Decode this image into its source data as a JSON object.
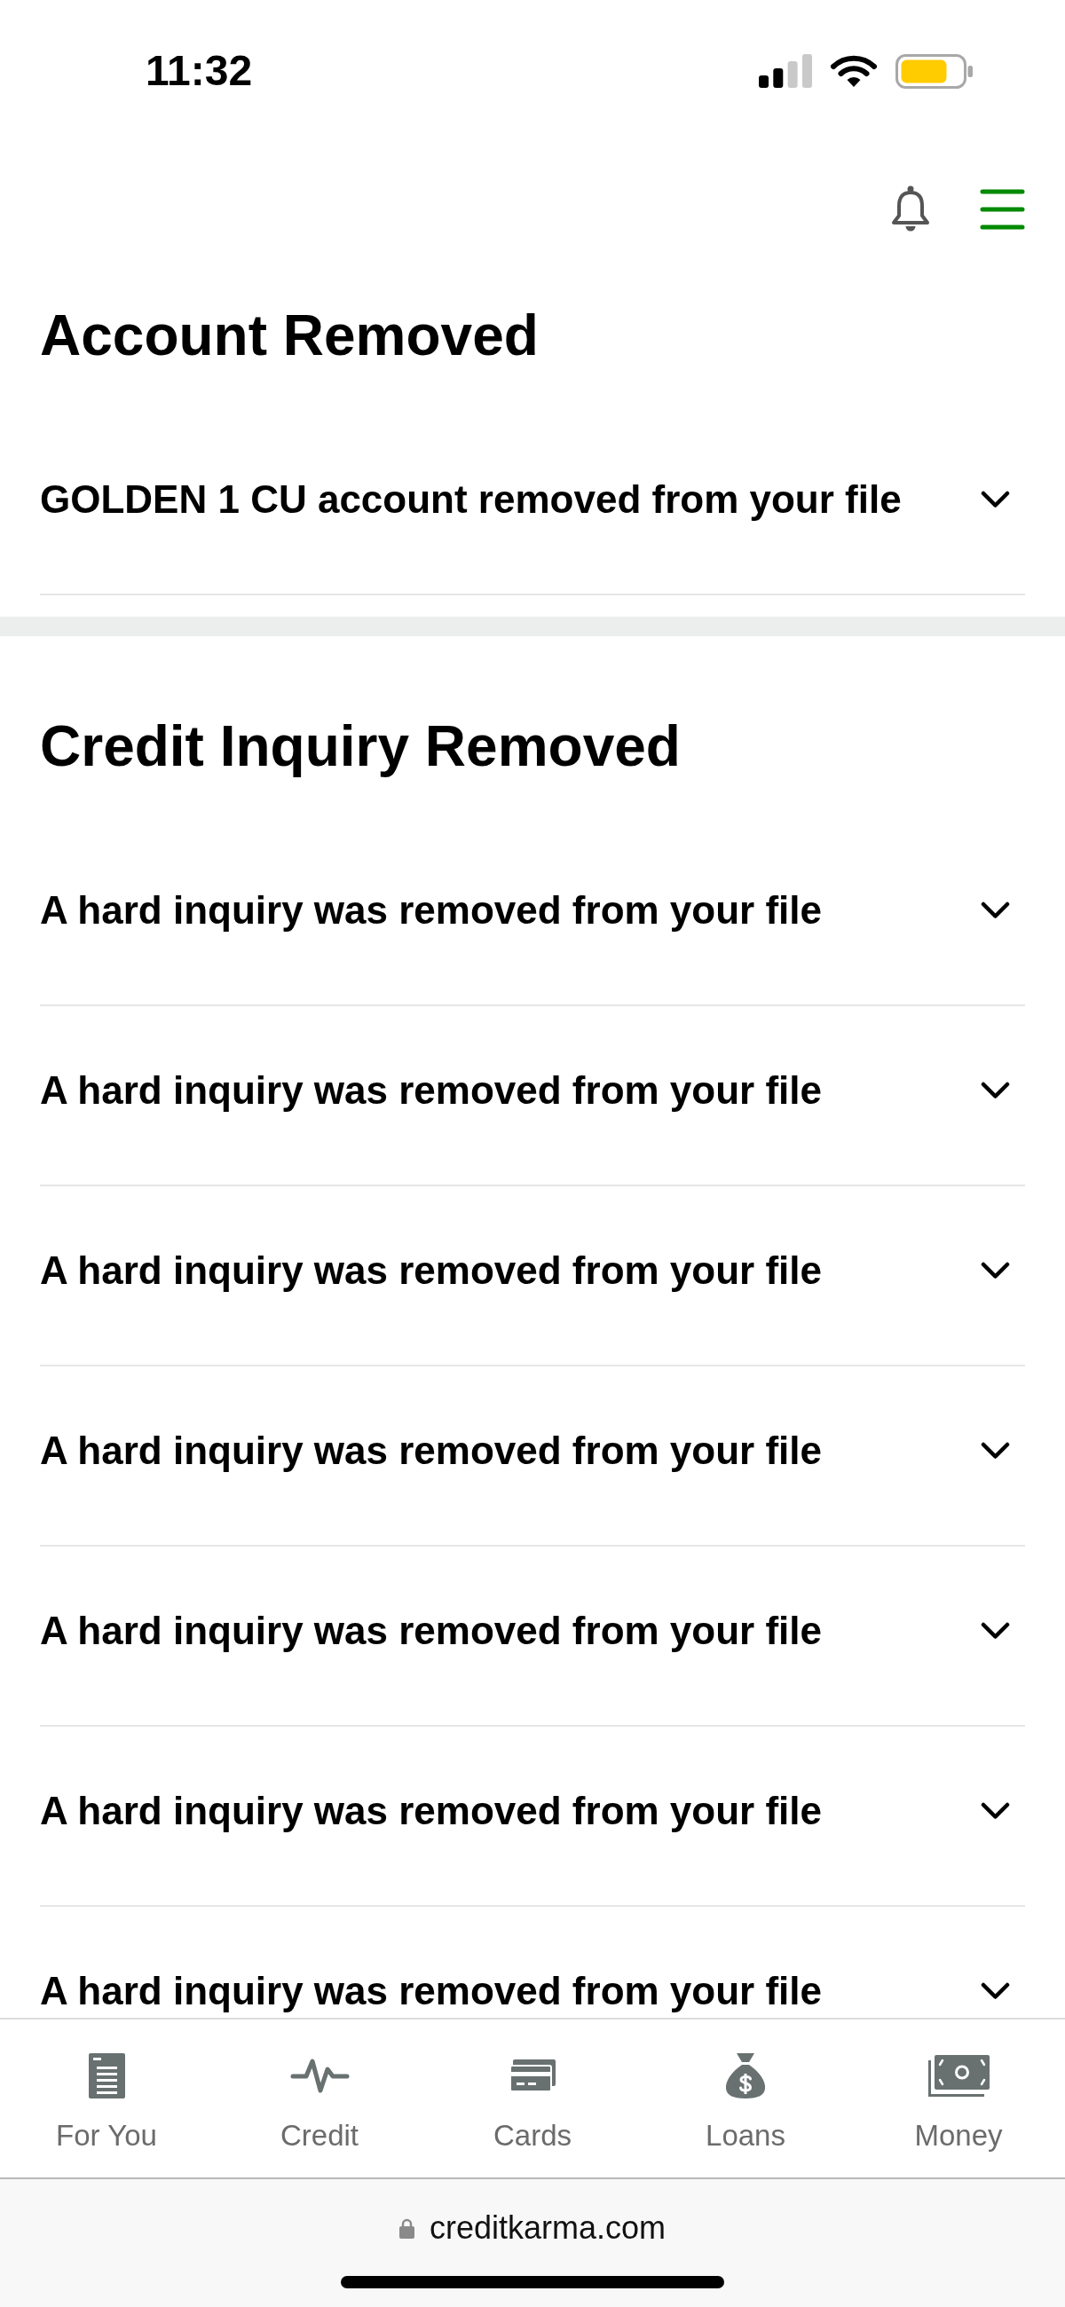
{
  "status_bar": {
    "time": "11:32"
  },
  "sections": [
    {
      "title": "Account Removed",
      "items": [
        {
          "text": "GOLDEN 1 CU account removed from your file",
          "expanded": false
        }
      ]
    },
    {
      "title": "Credit Inquiry Removed",
      "items": [
        {
          "text": "A hard inquiry was removed from your file",
          "expanded": false
        },
        {
          "text": "A hard inquiry was removed from your file",
          "expanded": false
        },
        {
          "text": "A hard inquiry was removed from your file",
          "expanded": false
        },
        {
          "text": "A hard inquiry was removed from your file",
          "expanded": false
        },
        {
          "text": "A hard inquiry was removed from your file",
          "expanded": false
        },
        {
          "text": "A hard inquiry was removed from your file",
          "expanded": false
        },
        {
          "text": "A hard inquiry was removed from your file",
          "expanded": false
        }
      ]
    }
  ],
  "bottom_nav": [
    {
      "label": "For You",
      "selected": false
    },
    {
      "label": "Credit",
      "selected": false
    },
    {
      "label": "Cards",
      "selected": false
    },
    {
      "label": "Loans",
      "selected": false
    },
    {
      "label": "Money",
      "selected": false
    }
  ],
  "address_bar": {
    "url": "creditkarma.com"
  }
}
